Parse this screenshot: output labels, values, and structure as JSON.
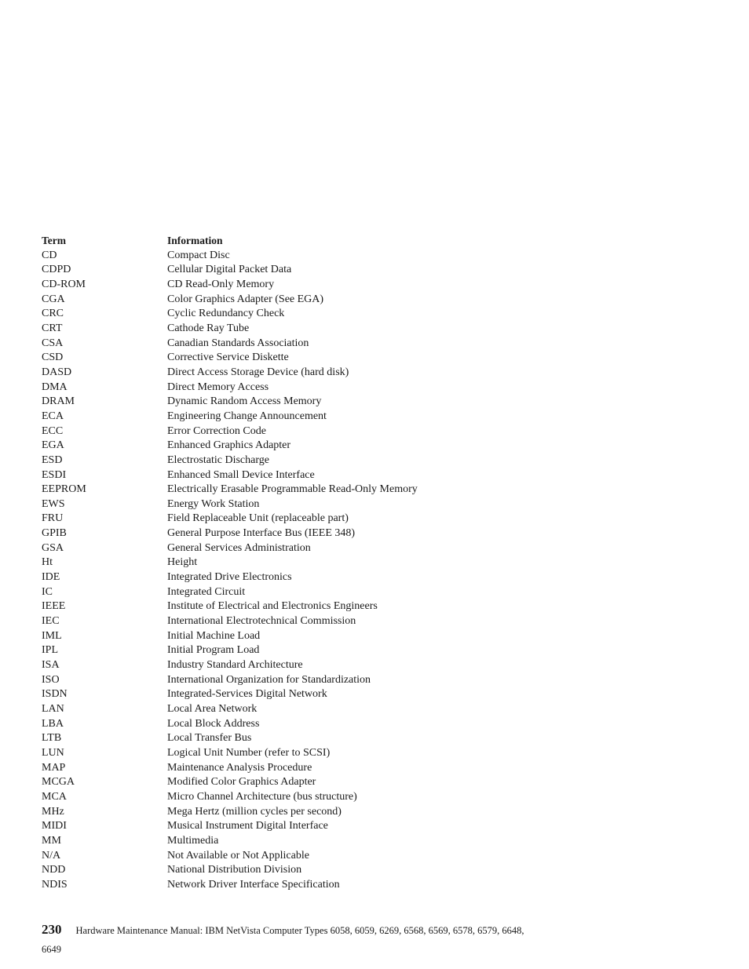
{
  "glossary": {
    "headers": {
      "term": "Term",
      "information": "Information"
    },
    "rows": [
      {
        "term": "CD",
        "information": "Compact Disc"
      },
      {
        "term": "CDPD",
        "information": "Cellular Digital Packet Data"
      },
      {
        "term": "CD-ROM",
        "information": "CD Read-Only Memory"
      },
      {
        "term": "CGA",
        "information": "Color Graphics Adapter (See EGA)"
      },
      {
        "term": "CRC",
        "information": "Cyclic Redundancy Check"
      },
      {
        "term": "CRT",
        "information": "Cathode Ray Tube"
      },
      {
        "term": "CSA",
        "information": "Canadian Standards Association"
      },
      {
        "term": "CSD",
        "information": "Corrective Service Diskette"
      },
      {
        "term": "DASD",
        "information": "Direct Access Storage Device (hard disk)"
      },
      {
        "term": "DMA",
        "information": "Direct Memory Access"
      },
      {
        "term": "DRAM",
        "information": "Dynamic Random Access Memory"
      },
      {
        "term": "ECA",
        "information": "Engineering Change Announcement"
      },
      {
        "term": "ECC",
        "information": "Error Correction Code"
      },
      {
        "term": "EGA",
        "information": "Enhanced Graphics Adapter"
      },
      {
        "term": "ESD",
        "information": "Electrostatic Discharge"
      },
      {
        "term": "ESDI",
        "information": "Enhanced Small Device Interface"
      },
      {
        "term": "EEPROM",
        "information": "Electrically Erasable Programmable Read-Only Memory"
      },
      {
        "term": "EWS",
        "information": "Energy Work Station"
      },
      {
        "term": "FRU",
        "information": "Field Replaceable Unit (replaceable part)"
      },
      {
        "term": "GPIB",
        "information": "General Purpose Interface Bus (IEEE 348)"
      },
      {
        "term": "GSA",
        "information": "General Services Administration"
      },
      {
        "term": "Ht",
        "information": "Height"
      },
      {
        "term": "IDE",
        "information": "Integrated Drive Electronics"
      },
      {
        "term": "IC",
        "information": "Integrated Circuit"
      },
      {
        "term": "IEEE",
        "information": "Institute of Electrical and Electronics Engineers"
      },
      {
        "term": "IEC",
        "information": "International Electrotechnical Commission"
      },
      {
        "term": "IML",
        "information": "Initial Machine Load"
      },
      {
        "term": "IPL",
        "information": "Initial Program Load"
      },
      {
        "term": "ISA",
        "information": "Industry Standard Architecture"
      },
      {
        "term": "ISO",
        "information": "International Organization for Standardization"
      },
      {
        "term": "ISDN",
        "information": "Integrated-Services Digital Network"
      },
      {
        "term": "LAN",
        "information": "Local Area Network"
      },
      {
        "term": "LBA",
        "information": "Local Block Address"
      },
      {
        "term": "LTB",
        "information": "Local Transfer Bus"
      },
      {
        "term": "LUN",
        "information": "Logical Unit Number (refer to SCSI)"
      },
      {
        "term": "MAP",
        "information": "Maintenance Analysis Procedure"
      },
      {
        "term": "MCGA",
        "information": "Modified Color Graphics Adapter"
      },
      {
        "term": "MCA",
        "information": "Micro Channel Architecture (bus structure)"
      },
      {
        "term": "MHz",
        "information": "Mega Hertz (million cycles per second)"
      },
      {
        "term": "MIDI",
        "information": "Musical Instrument Digital Interface"
      },
      {
        "term": "MM",
        "information": "Multimedia"
      },
      {
        "term": "N/A",
        "information": "Not Available or Not Applicable"
      },
      {
        "term": "NDD",
        "information": "National Distribution Division"
      },
      {
        "term": "NDIS",
        "information": "Network Driver Interface Specification"
      }
    ]
  },
  "footer": {
    "page_number": "230",
    "title": "Hardware Maintenance Manual: IBM NetVista Computer Types 6058, 6059, 6269, 6568, 6569, 6578, 6579, 6648,",
    "title_continued": "6649"
  }
}
